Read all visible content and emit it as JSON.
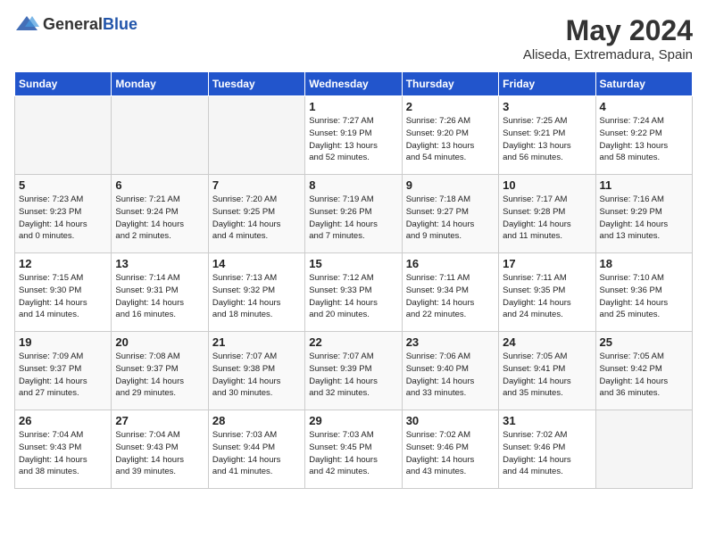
{
  "header": {
    "logo_general": "General",
    "logo_blue": "Blue",
    "month_year": "May 2024",
    "location": "Aliseda, Extremadura, Spain"
  },
  "days_of_week": [
    "Sunday",
    "Monday",
    "Tuesday",
    "Wednesday",
    "Thursday",
    "Friday",
    "Saturday"
  ],
  "weeks": [
    [
      {
        "num": "",
        "info": ""
      },
      {
        "num": "",
        "info": ""
      },
      {
        "num": "",
        "info": ""
      },
      {
        "num": "1",
        "info": "Sunrise: 7:27 AM\nSunset: 9:19 PM\nDaylight: 13 hours\nand 52 minutes."
      },
      {
        "num": "2",
        "info": "Sunrise: 7:26 AM\nSunset: 9:20 PM\nDaylight: 13 hours\nand 54 minutes."
      },
      {
        "num": "3",
        "info": "Sunrise: 7:25 AM\nSunset: 9:21 PM\nDaylight: 13 hours\nand 56 minutes."
      },
      {
        "num": "4",
        "info": "Sunrise: 7:24 AM\nSunset: 9:22 PM\nDaylight: 13 hours\nand 58 minutes."
      }
    ],
    [
      {
        "num": "5",
        "info": "Sunrise: 7:23 AM\nSunset: 9:23 PM\nDaylight: 14 hours\nand 0 minutes."
      },
      {
        "num": "6",
        "info": "Sunrise: 7:21 AM\nSunset: 9:24 PM\nDaylight: 14 hours\nand 2 minutes."
      },
      {
        "num": "7",
        "info": "Sunrise: 7:20 AM\nSunset: 9:25 PM\nDaylight: 14 hours\nand 4 minutes."
      },
      {
        "num": "8",
        "info": "Sunrise: 7:19 AM\nSunset: 9:26 PM\nDaylight: 14 hours\nand 7 minutes."
      },
      {
        "num": "9",
        "info": "Sunrise: 7:18 AM\nSunset: 9:27 PM\nDaylight: 14 hours\nand 9 minutes."
      },
      {
        "num": "10",
        "info": "Sunrise: 7:17 AM\nSunset: 9:28 PM\nDaylight: 14 hours\nand 11 minutes."
      },
      {
        "num": "11",
        "info": "Sunrise: 7:16 AM\nSunset: 9:29 PM\nDaylight: 14 hours\nand 13 minutes."
      }
    ],
    [
      {
        "num": "12",
        "info": "Sunrise: 7:15 AM\nSunset: 9:30 PM\nDaylight: 14 hours\nand 14 minutes."
      },
      {
        "num": "13",
        "info": "Sunrise: 7:14 AM\nSunset: 9:31 PM\nDaylight: 14 hours\nand 16 minutes."
      },
      {
        "num": "14",
        "info": "Sunrise: 7:13 AM\nSunset: 9:32 PM\nDaylight: 14 hours\nand 18 minutes."
      },
      {
        "num": "15",
        "info": "Sunrise: 7:12 AM\nSunset: 9:33 PM\nDaylight: 14 hours\nand 20 minutes."
      },
      {
        "num": "16",
        "info": "Sunrise: 7:11 AM\nSunset: 9:34 PM\nDaylight: 14 hours\nand 22 minutes."
      },
      {
        "num": "17",
        "info": "Sunrise: 7:11 AM\nSunset: 9:35 PM\nDaylight: 14 hours\nand 24 minutes."
      },
      {
        "num": "18",
        "info": "Sunrise: 7:10 AM\nSunset: 9:36 PM\nDaylight: 14 hours\nand 25 minutes."
      }
    ],
    [
      {
        "num": "19",
        "info": "Sunrise: 7:09 AM\nSunset: 9:37 PM\nDaylight: 14 hours\nand 27 minutes."
      },
      {
        "num": "20",
        "info": "Sunrise: 7:08 AM\nSunset: 9:37 PM\nDaylight: 14 hours\nand 29 minutes."
      },
      {
        "num": "21",
        "info": "Sunrise: 7:07 AM\nSunset: 9:38 PM\nDaylight: 14 hours\nand 30 minutes."
      },
      {
        "num": "22",
        "info": "Sunrise: 7:07 AM\nSunset: 9:39 PM\nDaylight: 14 hours\nand 32 minutes."
      },
      {
        "num": "23",
        "info": "Sunrise: 7:06 AM\nSunset: 9:40 PM\nDaylight: 14 hours\nand 33 minutes."
      },
      {
        "num": "24",
        "info": "Sunrise: 7:05 AM\nSunset: 9:41 PM\nDaylight: 14 hours\nand 35 minutes."
      },
      {
        "num": "25",
        "info": "Sunrise: 7:05 AM\nSunset: 9:42 PM\nDaylight: 14 hours\nand 36 minutes."
      }
    ],
    [
      {
        "num": "26",
        "info": "Sunrise: 7:04 AM\nSunset: 9:43 PM\nDaylight: 14 hours\nand 38 minutes."
      },
      {
        "num": "27",
        "info": "Sunrise: 7:04 AM\nSunset: 9:43 PM\nDaylight: 14 hours\nand 39 minutes."
      },
      {
        "num": "28",
        "info": "Sunrise: 7:03 AM\nSunset: 9:44 PM\nDaylight: 14 hours\nand 41 minutes."
      },
      {
        "num": "29",
        "info": "Sunrise: 7:03 AM\nSunset: 9:45 PM\nDaylight: 14 hours\nand 42 minutes."
      },
      {
        "num": "30",
        "info": "Sunrise: 7:02 AM\nSunset: 9:46 PM\nDaylight: 14 hours\nand 43 minutes."
      },
      {
        "num": "31",
        "info": "Sunrise: 7:02 AM\nSunset: 9:46 PM\nDaylight: 14 hours\nand 44 minutes."
      },
      {
        "num": "",
        "info": ""
      }
    ]
  ]
}
